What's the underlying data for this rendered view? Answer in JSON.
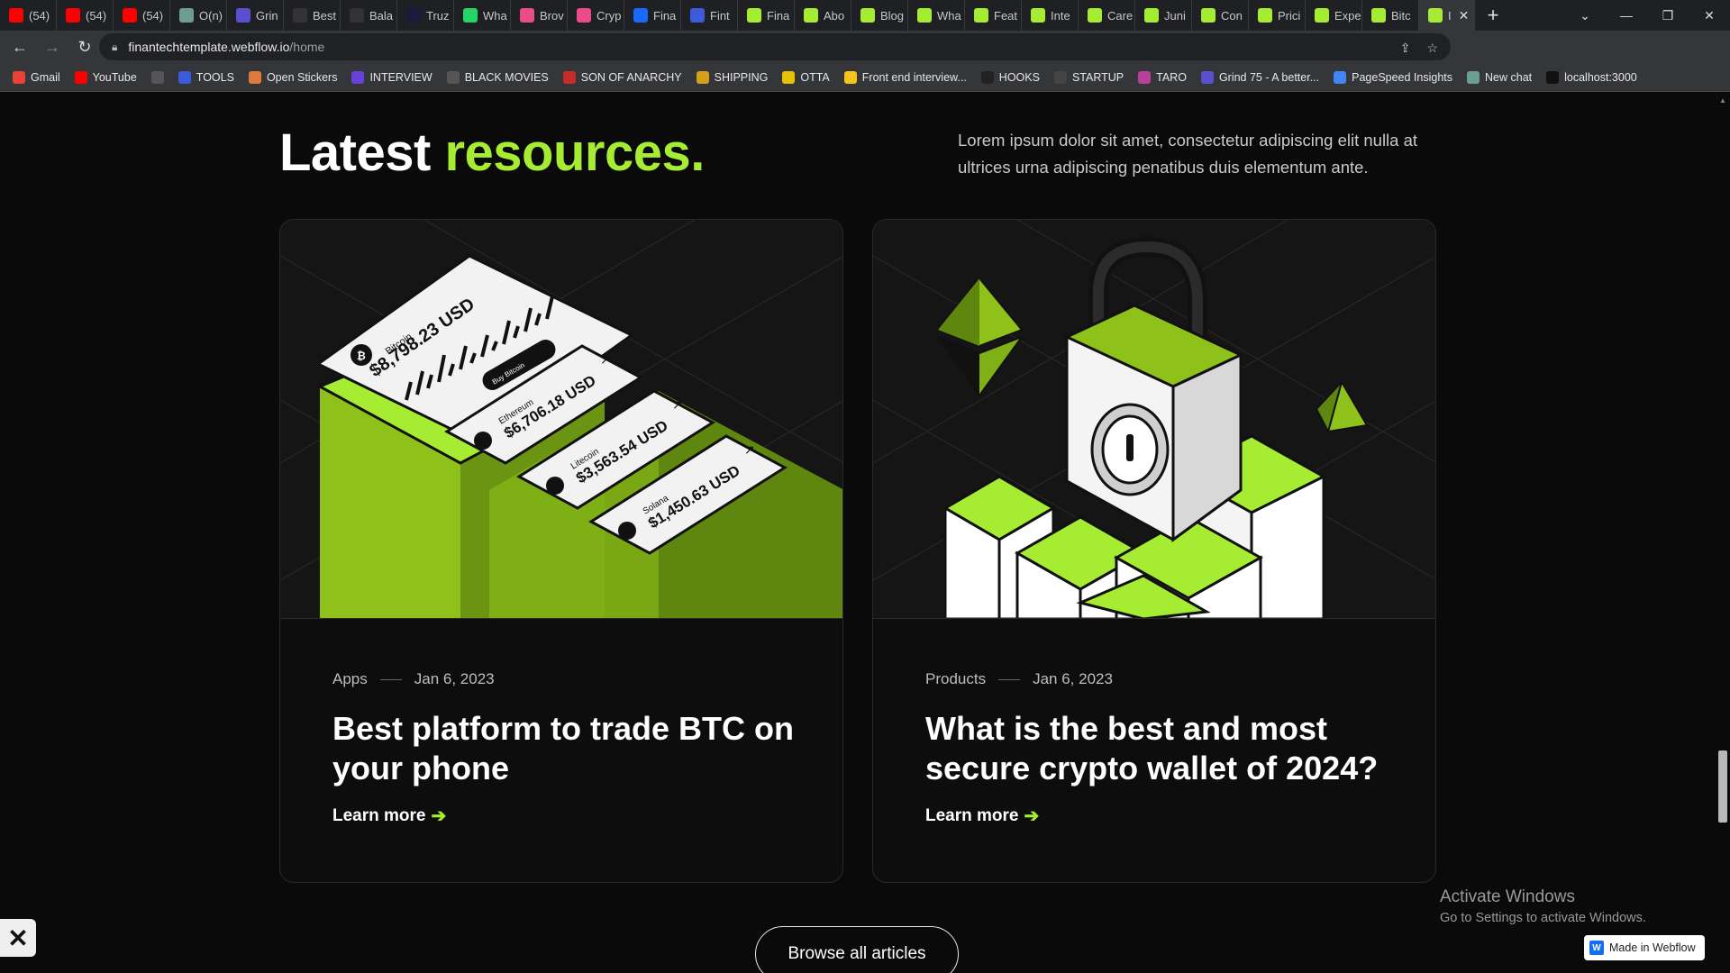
{
  "browser": {
    "tabs": [
      {
        "label": "(54)",
        "icon": "youtube-icon",
        "color": "#ff0000"
      },
      {
        "label": "(54)",
        "icon": "youtube-icon",
        "color": "#ff0000"
      },
      {
        "label": "(54)",
        "icon": "youtube-icon",
        "color": "#ff0000"
      },
      {
        "label": "O(n)",
        "icon": "openai-icon",
        "color": "#6b9e8c"
      },
      {
        "label": "Grin",
        "icon": "grind-icon",
        "color": "#5a4fcf"
      },
      {
        "label": "Best",
        "icon": "crypto-icon",
        "color": "#333333"
      },
      {
        "label": "Bala",
        "icon": "crypto-icon",
        "color": "#333333"
      },
      {
        "label": "Truz",
        "icon": "site-icon",
        "color": "#1a1a3a"
      },
      {
        "label": "Wha",
        "icon": "whatsapp-icon",
        "color": "#25d366"
      },
      {
        "label": "Brov",
        "icon": "dribbble-icon",
        "color": "#ea4c89"
      },
      {
        "label": "Cryp",
        "icon": "dribbble-icon",
        "color": "#ea4c89"
      },
      {
        "label": "Fina",
        "icon": "behance-icon",
        "color": "#1769ff"
      },
      {
        "label": "Fint",
        "icon": "dots-icon",
        "color": "#3b5bdb"
      },
      {
        "label": "Fina",
        "icon": "webflow-template-icon",
        "color": "#a6ec32"
      },
      {
        "label": "Abo",
        "icon": "webflow-template-icon",
        "color": "#a6ec32"
      },
      {
        "label": "Blog",
        "icon": "webflow-template-icon",
        "color": "#a6ec32"
      },
      {
        "label": "Wha",
        "icon": "webflow-template-icon",
        "color": "#a6ec32"
      },
      {
        "label": "Feat",
        "icon": "webflow-template-icon",
        "color": "#a6ec32"
      },
      {
        "label": "Inte",
        "icon": "webflow-template-icon",
        "color": "#a6ec32"
      },
      {
        "label": "Care",
        "icon": "webflow-template-icon",
        "color": "#a6ec32"
      },
      {
        "label": "Juni",
        "icon": "webflow-template-icon",
        "color": "#a6ec32"
      },
      {
        "label": "Con",
        "icon": "webflow-template-icon",
        "color": "#a6ec32"
      },
      {
        "label": "Prici",
        "icon": "webflow-template-icon",
        "color": "#a6ec32"
      },
      {
        "label": "Expe",
        "icon": "webflow-template-icon",
        "color": "#a6ec32"
      },
      {
        "label": "Bitc",
        "icon": "webflow-template-icon",
        "color": "#a6ec32"
      },
      {
        "label": "I",
        "icon": "webflow-template-icon",
        "color": "#a6ec32"
      }
    ],
    "url_host": "finantechtemplate.webflow.io",
    "url_path": "/home",
    "bookmarks": [
      {
        "label": "Gmail",
        "icon": "gmail-icon",
        "color": "#ea4335"
      },
      {
        "label": "YouTube",
        "icon": "youtube-icon",
        "color": "#ff0000"
      },
      {
        "label": "",
        "icon": "globe-icon",
        "color": "#555555"
      },
      {
        "label": "TOOLS",
        "icon": "folder-icon",
        "color": "#3b5bdb"
      },
      {
        "label": "Open Stickers",
        "icon": "sticker-icon",
        "color": "#e07a3c"
      },
      {
        "label": "INTERVIEW",
        "icon": "interview-icon",
        "color": "#6741d9"
      },
      {
        "label": "BLACK MOVIES",
        "icon": "globe-icon",
        "color": "#555555"
      },
      {
        "label": "SON OF ANARCHY",
        "icon": "flag-icon",
        "color": "#c92a2a"
      },
      {
        "label": "SHIPPING",
        "icon": "chevrons-icon",
        "color": "#d4a017"
      },
      {
        "label": "OTTA",
        "icon": "otta-icon",
        "color": "#e6c200"
      },
      {
        "label": "Front end interview...",
        "icon": "bookmark-icon",
        "color": "#f5c518"
      },
      {
        "label": "HOOKS",
        "icon": "hooks-icon",
        "color": "#222222"
      },
      {
        "label": "STARTUP",
        "icon": "list-icon",
        "color": "#444444"
      },
      {
        "label": "TARO",
        "icon": "taro-icon",
        "color": "#b9409a"
      },
      {
        "label": "Grind 75 - A better...",
        "icon": "grind-icon",
        "color": "#5a4fcf"
      },
      {
        "label": "PageSpeed Insights",
        "icon": "pagespeed-icon",
        "color": "#4285f4"
      },
      {
        "label": "New chat",
        "icon": "openai-icon",
        "color": "#6b9e8c"
      },
      {
        "label": "localhost:3000",
        "icon": "triangle-icon",
        "color": "#111111"
      }
    ]
  },
  "section": {
    "heading_main": "Latest",
    "heading_accent": "resources.",
    "lead": "Lorem ipsum dolor sit amet, consectetur adipiscing elit nulla at ultrices urna adipiscing penatibus duis elementum ante.",
    "accent_color": "#a6ec32"
  },
  "cards": [
    {
      "category": "Apps",
      "date": "Jan 6, 2023",
      "title": "Best platform to trade BTC on your phone",
      "link": "Learn more",
      "illustration": {
        "main_label": "Bitcoin",
        "main_value": "$8,798.23 USD",
        "buy_label": "Buy Bitcoin",
        "items": [
          {
            "name": "Ethereum",
            "value": "$6,706.18 USD"
          },
          {
            "name": "Litecoin",
            "value": "$3,563.54 USD"
          },
          {
            "name": "Solana",
            "value": "$1,450.63 USD"
          }
        ]
      }
    },
    {
      "category": "Products",
      "date": "Jan 6, 2023",
      "title": "What is the best and most secure crypto wallet of 2024?",
      "link": "Learn more"
    }
  ],
  "browse_button": "Browse all articles",
  "windows_notice": {
    "title": "Activate Windows",
    "subtitle": "Go to Settings to activate Windows."
  },
  "made_in_webflow": "Made in Webflow"
}
